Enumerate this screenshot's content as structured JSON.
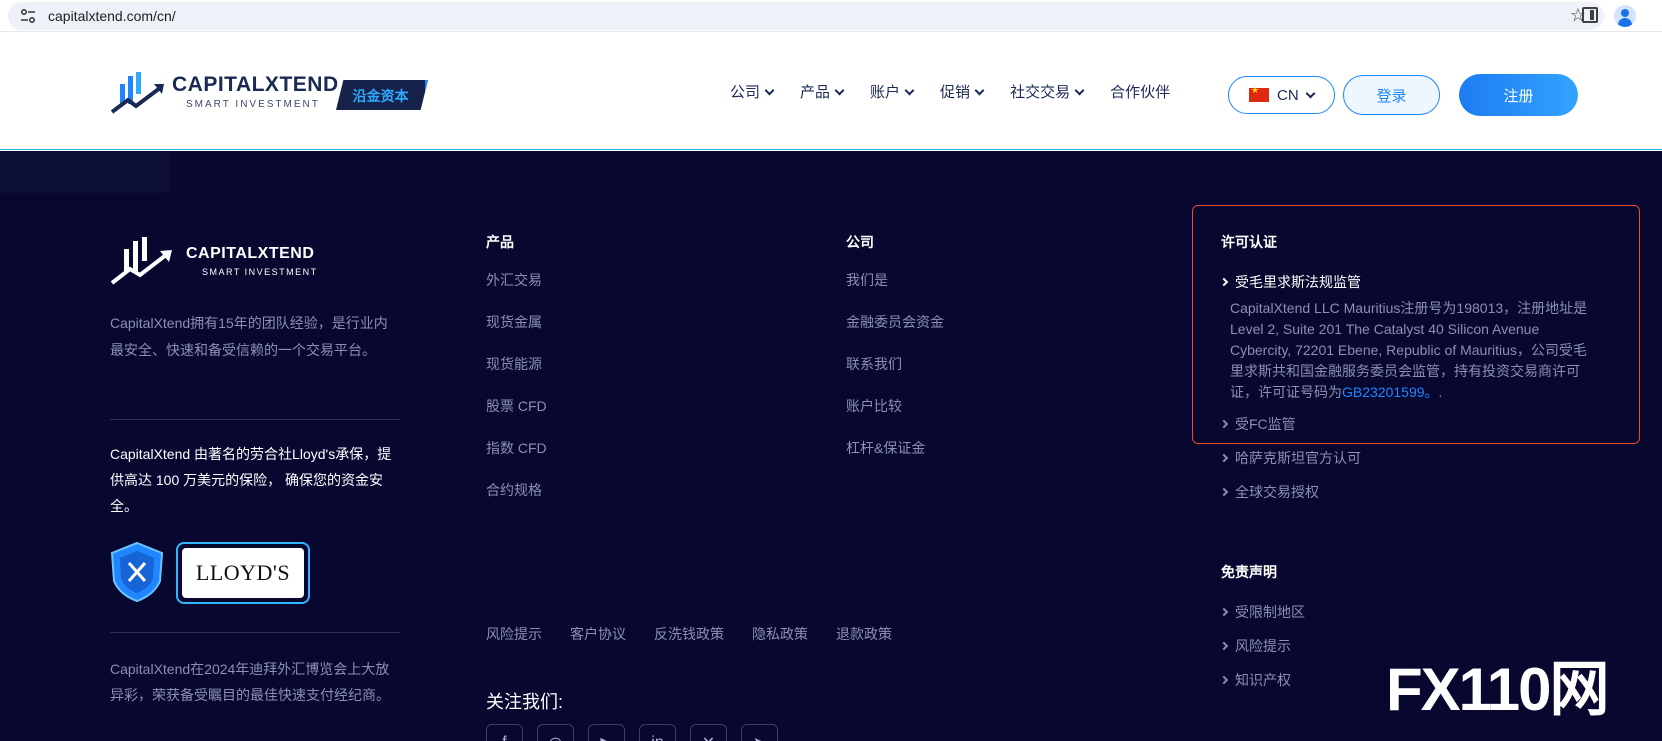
{
  "browser": {
    "url": "capitalxtend.com/cn/"
  },
  "header": {
    "logo_name": "CAPITALXTEND",
    "logo_sub": "SMART INVESTMENT",
    "logo_cn": "沿金资本",
    "nav": [
      {
        "label": "公司"
      },
      {
        "label": "产品"
      },
      {
        "label": "账户"
      },
      {
        "label": "促销"
      },
      {
        "label": "社交交易"
      },
      {
        "label": "合作伙伴"
      }
    ],
    "lang": "CN",
    "login": "登录",
    "register": "注册"
  },
  "footer": {
    "logo_name": "CAPITALXTEND",
    "logo_sub": "SMART INVESTMENT",
    "about": "CapitalXtend拥有15年的团队经验，是行业内最安全、快速和备受信赖的一个交易平台。",
    "lloyds_text": "CapitalXtend 由著名的劳合社Lloyd's承保，提供高达 100 万美元的保险， 确保您的资金安全。",
    "lloyds_badge": "LLOYD'S",
    "expo_text": "CapitalXtend在2024年迪拜外汇博览会上大放异彩，荣获备受瞩目的最佳快速支付经纪商。",
    "products": {
      "title": "产品",
      "items": [
        "外汇交易",
        "现货金属",
        "现货能源",
        "股票 CFD",
        "指数 CFD",
        "合约规格"
      ]
    },
    "company": {
      "title": "公司",
      "items": [
        "我们是",
        "金融委员会资金",
        "联系我们",
        "账户比较",
        "杠杆&保证金"
      ]
    },
    "legal_links": [
      "风险提示",
      "客户协议",
      "反洗钱政策",
      "隐私政策",
      "退款政策"
    ],
    "follow_title": "关注我们:",
    "license": {
      "title": "许可认证",
      "mauritius_label": "受毛里求斯法规监管",
      "mauritius_detail_pre": "CapitalXtend LLC Mauritius注册号为198013，注册地址是Level 2, Suite 201 The Catalyst 40 Silicon Avenue Cybercity, 72201 Ebene, Republic of Mauritius，公司受毛里求斯共和国金融服务委员会监管，持有投资交易商许可证，许可证号码为",
      "mauritius_detail_link": "GB23201599。",
      "mauritius_detail_post": ".",
      "fc_label": "受FC监管",
      "kazakh_label": "哈萨克斯坦官方认可",
      "global_label": "全球交易授权"
    },
    "disclaimer": {
      "title": "免责声明",
      "items": [
        "受限制地区",
        "风险提示",
        "知识产权"
      ]
    },
    "watermark": "FX110网"
  },
  "colors": {
    "footer_bg": "#070730",
    "accent_blue": "#1f86ff",
    "highlight_border": "#e84a2b"
  }
}
